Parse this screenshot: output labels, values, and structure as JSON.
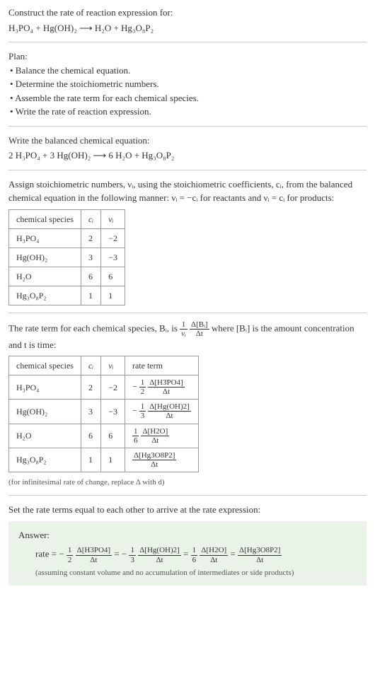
{
  "title": "Construct the rate of reaction expression for:",
  "unbalanced_eq": "H₃PO₄ + Hg(OH)₂  ⟶  H₂O + Hg₃O₈P₂",
  "plan_label": "Plan:",
  "plan_items": [
    "• Balance the chemical equation.",
    "• Determine the stoichiometric numbers.",
    "• Assemble the rate term for each chemical species.",
    "• Write the rate of reaction expression."
  ],
  "balanced_label": "Write the balanced chemical equation:",
  "balanced_eq": "2 H₃PO₄ + 3 Hg(OH)₂  ⟶  6 H₂O + Hg₃O₈P₂",
  "stoich_text_1": "Assign stoichiometric numbers, νᵢ, using the stoichiometric coefficients, cᵢ, from the balanced chemical equation in the following manner: νᵢ = −cᵢ for reactants and νᵢ = cᵢ for products:",
  "table1": {
    "headers": [
      "chemical species",
      "cᵢ",
      "νᵢ"
    ],
    "rows": [
      [
        "H₃PO₄",
        "2",
        "−2"
      ],
      [
        "Hg(OH)₂",
        "3",
        "−3"
      ],
      [
        "H₂O",
        "6",
        "6"
      ],
      [
        "Hg₃O₈P₂",
        "1",
        "1"
      ]
    ]
  },
  "rate_term_text_1": "The rate term for each chemical species, Bᵢ, is ",
  "rate_term_frac1_num": "1",
  "rate_term_frac1_den": "νᵢ",
  "rate_term_frac2_num": "Δ[Bᵢ]",
  "rate_term_frac2_den": "Δt",
  "rate_term_text_2": " where [Bᵢ] is the amount concentration and t is time:",
  "table2": {
    "headers": [
      "chemical species",
      "cᵢ",
      "νᵢ",
      "rate term"
    ],
    "rows": [
      {
        "species": "H₃PO₄",
        "c": "2",
        "v": "−2",
        "coef": "−",
        "num": "1",
        "den": "2",
        "dnum": "Δ[H3PO4]",
        "dden": "Δt"
      },
      {
        "species": "Hg(OH)₂",
        "c": "3",
        "v": "−3",
        "coef": "−",
        "num": "1",
        "den": "3",
        "dnum": "Δ[Hg(OH)2]",
        "dden": "Δt"
      },
      {
        "species": "H₂O",
        "c": "6",
        "v": "6",
        "coef": "",
        "num": "1",
        "den": "6",
        "dnum": "Δ[H2O]",
        "dden": "Δt"
      },
      {
        "species": "Hg₃O₈P₂",
        "c": "1",
        "v": "1",
        "coef": "",
        "num": "",
        "den": "",
        "dnum": "Δ[Hg3O8P2]",
        "dden": "Δt"
      }
    ]
  },
  "inf_note": "(for infinitesimal rate of change, replace Δ with d)",
  "set_equal_text": "Set the rate terms equal to each other to arrive at the rate expression:",
  "answer_label": "Answer:",
  "answer_prefix": "rate = −",
  "answer_terms": [
    {
      "sign": "",
      "num": "1",
      "den": "2",
      "dnum": "Δ[H3PO4]",
      "dden": "Δt"
    },
    {
      "sign": " = −",
      "num": "1",
      "den": "3",
      "dnum": "Δ[Hg(OH)2]",
      "dden": "Δt"
    },
    {
      "sign": " = ",
      "num": "1",
      "den": "6",
      "dnum": "Δ[H2O]",
      "dden": "Δt"
    },
    {
      "sign": " = ",
      "num": "",
      "den": "",
      "dnum": "Δ[Hg3O8P2]",
      "dden": "Δt"
    }
  ],
  "answer_note": "(assuming constant volume and no accumulation of intermediates or side products)"
}
